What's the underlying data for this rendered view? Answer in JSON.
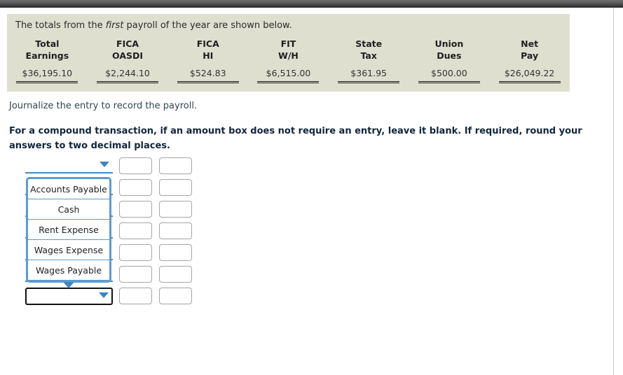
{
  "panel": {
    "intro_before": "The totals from the ",
    "intro_emphasis": "first",
    "intro_after": " payroll of the year are shown below."
  },
  "chart_data": {
    "type": "table",
    "title": "The totals from the first payroll of the year are shown below.",
    "columns": [
      {
        "line1": "Total",
        "line2": "Earnings"
      },
      {
        "line1": "FICA",
        "line2": "OASDI"
      },
      {
        "line1": "FICA",
        "line2": "HI"
      },
      {
        "line1": "FIT",
        "line2": "W/H"
      },
      {
        "line1": "State",
        "line2": "Tax"
      },
      {
        "line1": "Union",
        "line2": "Dues"
      },
      {
        "line1": "Net",
        "line2": "Pay"
      }
    ],
    "categories": [
      "Total Earnings",
      "FICA OASDI",
      "FICA HI",
      "FIT W/H",
      "State Tax",
      "Union Dues",
      "Net Pay"
    ],
    "values": [
      36195.1,
      2244.1,
      524.83,
      6515.0,
      361.95,
      500.0,
      26049.22
    ],
    "value_labels": [
      "$36,195.10",
      "$2,244.10",
      "$524.83",
      "$6,515.00",
      "$361.95",
      "$500.00",
      "$26,049.22"
    ],
    "xlabel": "",
    "ylabel": "",
    "grid": false,
    "legend": false
  },
  "instructions": {
    "sub": "Journalize the entry to record the payroll.",
    "bold": "For a compound transaction, if an amount box does not require an entry, leave it blank. If required, round your answers to two decimal places."
  },
  "journal": {
    "rows": [
      {
        "account": "",
        "debit": "",
        "credit": ""
      },
      {
        "account": "",
        "debit": "",
        "credit": ""
      },
      {
        "account": "",
        "debit": "",
        "credit": ""
      },
      {
        "account": "",
        "debit": "",
        "credit": ""
      },
      {
        "account": "",
        "debit": "",
        "credit": ""
      },
      {
        "account": "",
        "debit": "",
        "credit": ""
      },
      {
        "account": "",
        "debit": "",
        "credit": ""
      }
    ]
  },
  "dropdown": {
    "open": true,
    "options": [
      "Accounts Payable",
      "Cash",
      "Rent Expense",
      "Wages Expense",
      "Wages Payable"
    ]
  },
  "colors": {
    "panel_background": "#dfdfd0",
    "accent_blue": "#4a89bf",
    "dropdown_border": "#5b9bd1",
    "focus_border": "#111111",
    "heading_text": "#11263a",
    "body_text": "#31444f",
    "topbar_dark": "#3c3c3c"
  }
}
